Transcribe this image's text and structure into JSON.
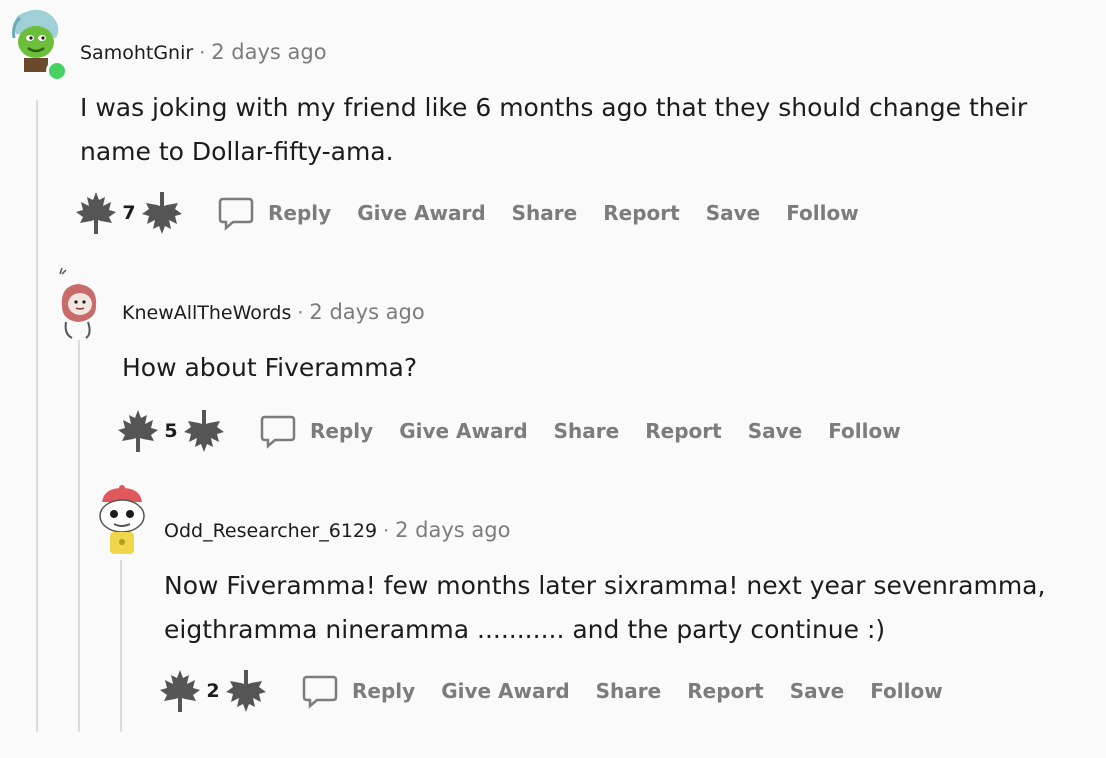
{
  "comments": [
    {
      "username": "SamohtGnir",
      "separator": "·",
      "time": "2 days ago",
      "body_lines": [
        "I was joking with my friend like 6 months ago that they should change their",
        "name to Dollar-fifty-ama."
      ],
      "votes": "7",
      "actions": {
        "reply": "Reply",
        "award": "Give Award",
        "share": "Share",
        "report": "Report",
        "save": "Save",
        "follow": "Follow"
      },
      "online": true
    },
    {
      "username": "KnewAllTheWords",
      "separator": "·",
      "time": "2 days ago",
      "body_lines": [
        "How about Fiveramma?"
      ],
      "votes": "5",
      "actions": {
        "reply": "Reply",
        "award": "Give Award",
        "share": "Share",
        "report": "Report",
        "save": "Save",
        "follow": "Follow"
      }
    },
    {
      "username": "Odd_Researcher_6129",
      "separator": "·",
      "time": "2 days ago",
      "body_lines": [
        "Now Fiveramma! few months later sixramma! next year sevenramma,",
        "eigthramma nineramma ........... and the party continue :)"
      ],
      "votes": "2",
      "actions": {
        "reply": "Reply",
        "award": "Give Award",
        "share": "Share",
        "report": "Report",
        "save": "Save",
        "follow": "Follow"
      }
    }
  ],
  "colors": {
    "text": "#1c1c1c",
    "muted": "#7c7c7c",
    "online": "#46d160",
    "thread_line": "#dcdcdc"
  },
  "icons": {
    "upvote": "maple-leaf-upvote-icon",
    "downvote": "maple-leaf-downvote-icon",
    "reply": "speech-bubble-icon"
  }
}
